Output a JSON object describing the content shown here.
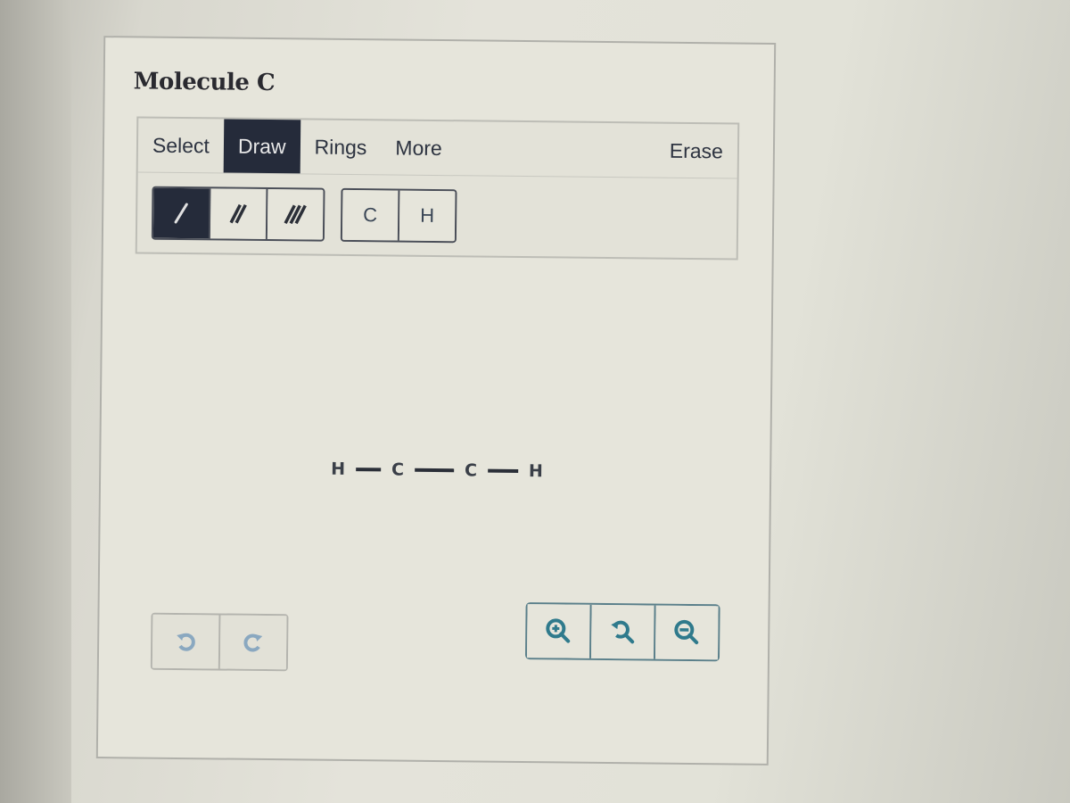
{
  "title": "Molecule C",
  "tabs": [
    {
      "label": "Select",
      "active": false
    },
    {
      "label": "Draw",
      "active": true
    },
    {
      "label": "Rings",
      "active": false
    },
    {
      "label": "More",
      "active": false
    }
  ],
  "erase_label": "Erase",
  "bond_tools": [
    {
      "name": "single-bond",
      "active": true
    },
    {
      "name": "double-bond",
      "active": false
    },
    {
      "name": "triple-bond",
      "active": false
    }
  ],
  "atom_tools": [
    "C",
    "H"
  ],
  "molecule": {
    "atoms": [
      "H",
      "C",
      "C",
      "H"
    ],
    "bonds": [
      "single",
      "single",
      "single"
    ]
  },
  "history": {
    "undo": "undo-icon",
    "redo": "redo-icon"
  },
  "zoom_controls": {
    "zoom_in": "zoom-in-icon",
    "reset": "zoom-reset-icon",
    "zoom_out": "zoom-out-icon"
  },
  "colors": {
    "active_tab": "#252b3a",
    "zoom_accent": "#2f7a8c",
    "history_icon": "#8aa8c0"
  }
}
